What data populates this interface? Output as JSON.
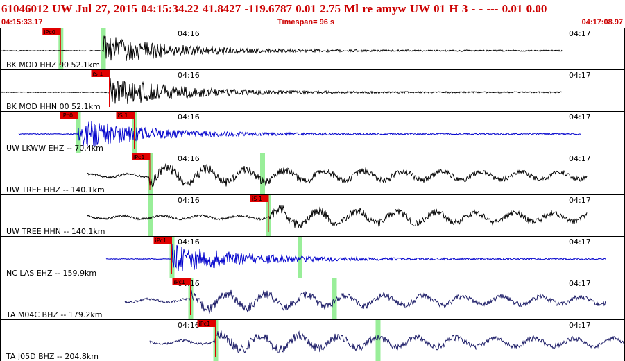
{
  "header": {
    "title": "61046012 UW Jul 27, 2015 04:15:34.22   41.8427 -119.6787  0.01 2.75 Ml re    amyw     UW 01 H    3  -  - ---  0.01 0.00",
    "start_time": "04:15:33.17",
    "timespan": "Timespan=  96 s",
    "end_time": "04:17:08.97"
  },
  "colors": {
    "header_text": "#cc0000",
    "trace_black": "#000000",
    "trace_blue": "#0000cc",
    "trace_navy": "#1a1a66",
    "pick_flag": "#e00000",
    "pick_window": "#99ee99"
  },
  "panels": [
    {
      "label": "BK MOD HHZ 00 52.1km",
      "time_marks": [
        "04:16",
        "04:17"
      ],
      "color": "black",
      "trace_span": [
        0.0,
        0.9
      ],
      "onset": 0.165,
      "picks": [
        {
          "text": "iPc0",
          "time": 0.097
        }
      ],
      "windows": [
        0.097,
        0.165
      ]
    },
    {
      "label": "BK MOD HHN 00 52.1km",
      "time_marks": [
        "04:16",
        "04:17"
      ],
      "color": "black",
      "trace_span": [
        0.0,
        0.9
      ],
      "onset": 0.175,
      "picks": [
        {
          "text": "iS 1",
          "time": 0.175
        }
      ],
      "windows": []
    },
    {
      "label": "UW LKWW EHZ -- 70.4km",
      "time_marks": [
        "04:16",
        "04:17"
      ],
      "color": "blue",
      "trace_span": [
        0.03,
        0.93
      ],
      "onset": 0.125,
      "picks": [
        {
          "text": "iPc0",
          "time": 0.125
        },
        {
          "text": "iS 1",
          "time": 0.215
        }
      ],
      "windows": [
        0.125,
        0.215
      ]
    },
    {
      "label": "UW TREE HHZ -- 140.1km",
      "time_marks": [
        "04:16",
        "04:17"
      ],
      "color": "black",
      "trace_span": [
        0.14,
        0.94
      ],
      "onset": 0.24,
      "picks": [
        {
          "text": "iPc1",
          "time": 0.24
        }
      ],
      "windows": [
        0.24,
        0.42
      ]
    },
    {
      "label": "UW TREE HHN -- 140.1km",
      "time_marks": [
        "04:16",
        "04:17"
      ],
      "color": "black",
      "trace_span": [
        0.14,
        0.94
      ],
      "onset": 0.43,
      "picks": [
        {
          "text": "iS 1",
          "time": 0.43
        }
      ],
      "windows": [
        0.24,
        0.43
      ]
    },
    {
      "label": "NC LAS EHZ -- 159.9km",
      "time_marks": [
        "04:16",
        "04:17"
      ],
      "color": "blue",
      "trace_span": [
        0.17,
        0.97
      ],
      "onset": 0.275,
      "picks": [
        {
          "text": "iPc1",
          "time": 0.275
        }
      ],
      "windows": [
        0.275,
        0.48
      ]
    },
    {
      "label": "TA M04C BHZ -- 179.2km",
      "time_marks": [
        "04:16",
        "04:17"
      ],
      "color": "navy",
      "trace_span": [
        0.2,
        0.97
      ],
      "onset": 0.305,
      "picks": [
        {
          "text": "iPc1",
          "time": 0.305
        }
      ],
      "windows": [
        0.305,
        0.535
      ]
    },
    {
      "label": "TA J05D BHZ -- 204.8km",
      "time_marks": [
        "04:16",
        "04:17"
      ],
      "color": "navy",
      "trace_span": [
        0.24,
        1.0
      ],
      "onset": 0.345,
      "picks": [
        {
          "text": "iPc1",
          "time": 0.345
        }
      ],
      "windows": [
        0.345,
        0.605
      ]
    }
  ]
}
